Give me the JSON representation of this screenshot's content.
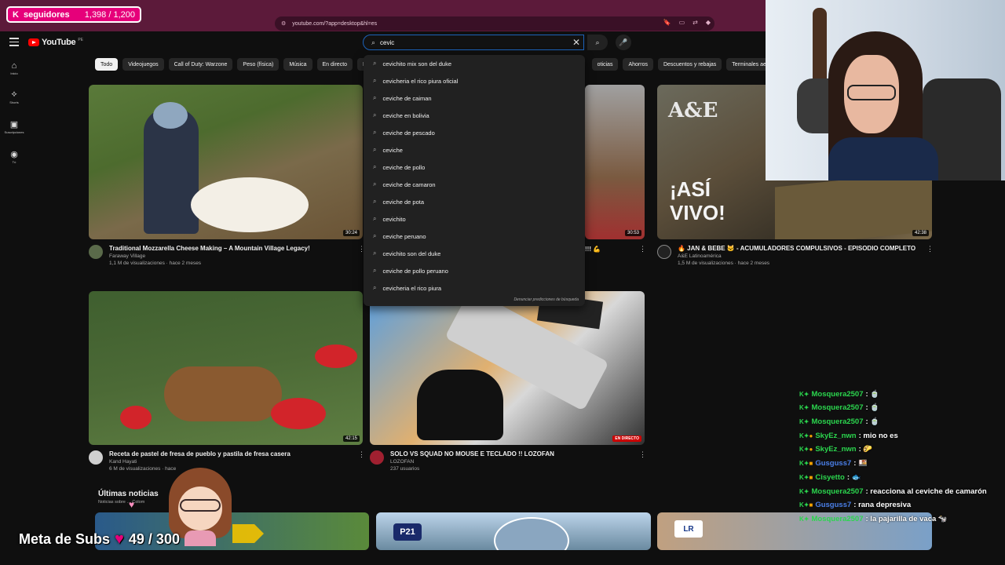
{
  "overlay": {
    "followers_label": "seguidores",
    "followers_count": "1,398 / 1,200",
    "meta_subs_label": "Meta de Subs",
    "meta_subs_count": "49 / 300"
  },
  "browser": {
    "url": "youtube.com/?app=desktop&hl=es"
  },
  "header": {
    "logo": "YouTube",
    "logo_country": "PE",
    "search_value": "cevic"
  },
  "sidebar": {
    "items": [
      {
        "label": "Inicio",
        "icon": "home-icon"
      },
      {
        "label": "Shorts",
        "icon": "shorts-icon"
      },
      {
        "label": "Suscripciones",
        "icon": "subscriptions-icon"
      },
      {
        "label": "Tú",
        "icon": "you-icon"
      }
    ]
  },
  "chips": [
    "Todo",
    "Videojuegos",
    "Call of Duty: Warzone",
    "Peso (física)",
    "Música",
    "En directo",
    "Pó",
    "oticias",
    "Ahorros",
    "Descuentos y rebajas",
    "Terminales aeroport"
  ],
  "suggestions": [
    "cevichito mix son del duke",
    "cevicheria el rico piura oficial",
    "ceviche de caiman",
    "ceviche en bolivia",
    "ceviche de pescado",
    "ceviche",
    "ceviche de pollo",
    "ceviche de camaron",
    "ceviche de pota",
    "cevichito",
    "ceviche peruano",
    "cevichito son del duke",
    "ceviche de pollo peruano",
    "cevicheria el rico piura"
  ],
  "report_predictions": "Denunciar predicciones de búsqueda",
  "videos": [
    {
      "title": "Traditional Mozzarella Cheese Making – A Mountain Village Legacy!",
      "channel": "Faraway Village",
      "stats": "1,1 M de visualizaciones · hace 2 meses",
      "duration": "30:24"
    },
    {
      "title": "!!! 💪",
      "duration": "30:53"
    },
    {
      "title": "🔥 JAN & BEBE 🐱 - ACUMULADORES COMPULSIVOS - EPISODIO COMPLETO",
      "channel": "A&E Latinoamérica",
      "stats": "1,5 M de visualizaciones · hace 2 meses",
      "duration": "42:38",
      "thumb_text_1": "¡ASÍ",
      "thumb_text_2": "VIVO!",
      "thumb_logo": "A&E"
    },
    {
      "title": "Receta de pastel de fresa de pueblo y pastila de fresa casera",
      "channel": "Kand Hayati",
      "stats": "6 M de visualizaciones · hace",
      "duration": "42:15"
    },
    {
      "title": "SOLO VS SQUAD NO MOUSE E TECLADO !! LOZOFAN",
      "channel": "LOZOFAN",
      "stats": "237 usuarios",
      "live": "EN DIRECTO"
    }
  ],
  "news": {
    "title": "Últimas noticias",
    "subtitle": "Noticias sobre … Colom",
    "logo_1": "P21",
    "logo_2": "LR"
  },
  "chat": [
    {
      "user": "Mosquera2507",
      "msg": ": 🍵",
      "color": "#2bd64e"
    },
    {
      "user": "Mosquera2507",
      "msg": ": 🍵",
      "color": "#2bd64e"
    },
    {
      "user": "Mosquera2507",
      "msg": ": 🍵",
      "color": "#2bd64e"
    },
    {
      "user": "SkyEz_nwn",
      "msg": ": mio no es",
      "color": "#2bd64e"
    },
    {
      "user": "SkyEz_nwn",
      "msg": ": 🌮",
      "color": "#2bd64e"
    },
    {
      "user": "Gusguss7",
      "msg": ": 🍱",
      "color": "#4a7fe8"
    },
    {
      "user": "Cisyetto",
      "msg": ": 🐟",
      "color": "#2bd64e"
    },
    {
      "user": "Mosquera2507",
      "msg": ": reacciona al ceviche de camarón",
      "color": "#2bd64e"
    },
    {
      "user": "Gusguss7",
      "msg": ": rana depresiva",
      "color": "#4a7fe8"
    },
    {
      "user": "Mosquera2507",
      "msg": ": la pajarilla de vaca 🐄",
      "color": "#2bd64e"
    }
  ]
}
